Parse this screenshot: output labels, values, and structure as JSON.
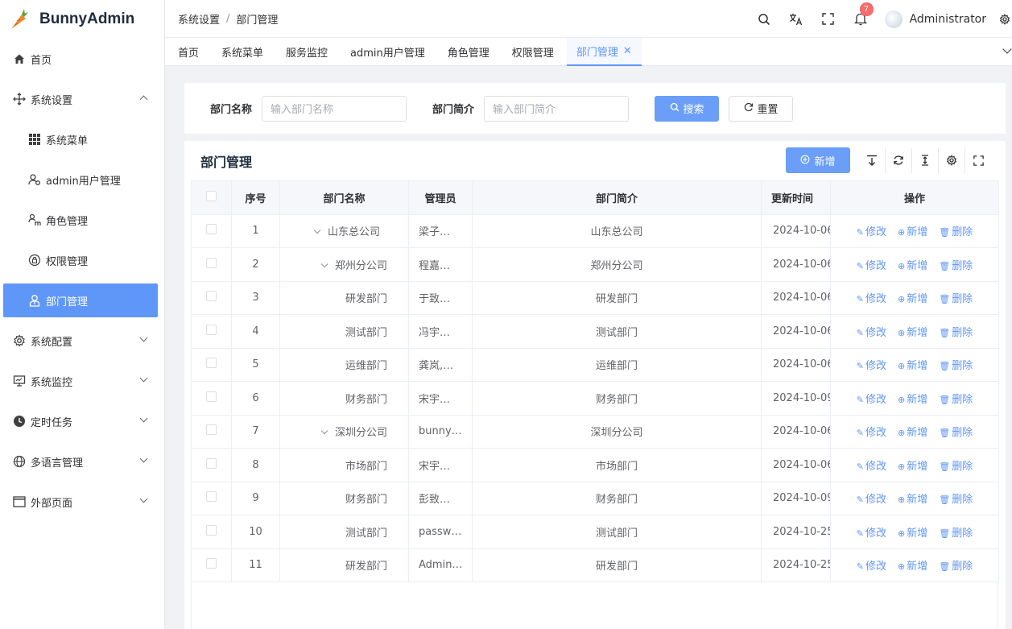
{
  "app": {
    "title": "BunnyAdmin"
  },
  "sidebar": {
    "items": [
      {
        "label": "首页",
        "icon": "home-icon"
      },
      {
        "label": "系统设置",
        "icon": "settings-move-icon",
        "expanded": true
      },
      {
        "label": "系统菜单",
        "icon": "grid-icon"
      },
      {
        "label": "admin用户管理",
        "icon": "user-gear-icon"
      },
      {
        "label": "角色管理",
        "icon": "role-icon"
      },
      {
        "label": "权限管理",
        "icon": "permission-icon"
      },
      {
        "label": "部门管理",
        "icon": "department-icon",
        "active": true
      },
      {
        "label": "系统配置",
        "icon": "cog-icon"
      },
      {
        "label": "系统监控",
        "icon": "monitor-icon"
      },
      {
        "label": "定时任务",
        "icon": "clock-icon"
      },
      {
        "label": "多语言管理",
        "icon": "globe-icon"
      },
      {
        "label": "外部页面",
        "icon": "window-icon"
      }
    ]
  },
  "header": {
    "breadcrumb": [
      "系统设置",
      "部门管理"
    ],
    "notification_count": "7",
    "user_name": "Administrator"
  },
  "tabs": [
    "首页",
    "系统菜单",
    "服务监控",
    "admin用户管理",
    "角色管理",
    "权限管理",
    "部门管理"
  ],
  "search": {
    "name_label": "部门名称",
    "name_placeholder": "输入部门名称",
    "summary_label": "部门简介",
    "summary_placeholder": "输入部门简介",
    "search_button": "搜索",
    "reset_button": "重置"
  },
  "table": {
    "title": "部门管理",
    "add_button": "新增",
    "columns": [
      "序号",
      "部门名称",
      "管理员",
      "部门简介",
      "更新时间",
      "操作"
    ],
    "op_edit": "修改",
    "op_add": "新增",
    "op_delete": "删除",
    "rows": [
      {
        "index": "1",
        "name": "山东总公司",
        "admin": "梁子…",
        "summary": "山东总公司",
        "updated": "2024-10-06",
        "tree": true
      },
      {
        "index": "2",
        "name": "郑州分公司",
        "admin": "程嘉…",
        "summary": "郑州分公司",
        "updated": "2024-10-06",
        "tree": true
      },
      {
        "index": "3",
        "name": "研发部门",
        "admin": "于致…",
        "summary": "研发部门",
        "updated": "2024-10-06",
        "tree": false
      },
      {
        "index": "4",
        "name": "测试部门",
        "admin": "冯宇…",
        "summary": "测试部门",
        "updated": "2024-10-06",
        "tree": false
      },
      {
        "index": "5",
        "name": "运维部门",
        "admin": "龚岚,…",
        "summary": "运维部门",
        "updated": "2024-10-06",
        "tree": false
      },
      {
        "index": "6",
        "name": "财务部门",
        "admin": "宋宇…",
        "summary": "财务部门",
        "updated": "2024-10-09",
        "tree": false
      },
      {
        "index": "7",
        "name": "深圳分公司",
        "admin": "bunny…",
        "summary": "深圳分公司",
        "updated": "2024-10-06",
        "tree": true
      },
      {
        "index": "8",
        "name": "市场部门",
        "admin": "宋宇…",
        "summary": "市场部门",
        "updated": "2024-10-06",
        "tree": false
      },
      {
        "index": "9",
        "name": "财务部门",
        "admin": "彭致…",
        "summary": "财务部门",
        "updated": "2024-10-09",
        "tree": false
      },
      {
        "index": "10",
        "name": "测试部门",
        "admin": "passw…",
        "summary": "测试部门",
        "updated": "2024-10-25",
        "tree": false
      },
      {
        "index": "11",
        "name": "研发部门",
        "admin": "Admin…",
        "summary": "研发部门",
        "updated": "2024-10-25",
        "tree": false
      }
    ]
  },
  "colors": {
    "accent": "#5f97f8",
    "badge": "#f56c6c"
  }
}
